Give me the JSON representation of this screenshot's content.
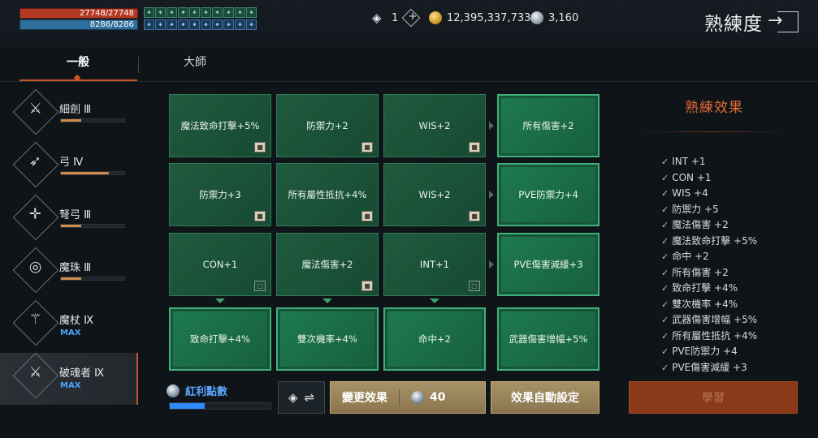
{
  "status": {
    "hp": "27748/27748",
    "mp": "8286/8286"
  },
  "buffs": [
    "✦",
    "✦",
    "✦",
    "✦",
    "✦",
    "✦",
    "✦",
    "✦",
    "✦",
    "✦",
    "✦",
    "✦",
    "✦",
    "✦",
    "✦",
    "✦",
    "✦",
    "✦",
    "✦",
    "✦"
  ],
  "currencies": {
    "diamond": "1",
    "gold": "12,395,337,733",
    "silver": "3,160"
  },
  "page_title": "熟練度",
  "tabs": [
    "一般",
    "大師"
  ],
  "weapons": [
    {
      "name": "細劍 Ⅲ",
      "progress": 0.32,
      "max": ""
    },
    {
      "name": "弓 Ⅳ",
      "progress": 0.75,
      "max": ""
    },
    {
      "name": "弩弓 Ⅲ",
      "progress": 0.32,
      "max": ""
    },
    {
      "name": "魔珠 Ⅲ",
      "progress": 0.32,
      "max": ""
    },
    {
      "name": "魔杖 Ⅸ",
      "progress": 1.0,
      "max": "MAX"
    },
    {
      "name": "破魂者 Ⅸ",
      "progress": 1.0,
      "max": "MAX"
    }
  ],
  "grid": [
    {
      "label": "魔法致命打擊+5%",
      "lock": "closed",
      "active": false
    },
    {
      "label": "防禦力+2",
      "lock": "closed",
      "active": false
    },
    {
      "label": "WIS+2",
      "lock": "closed",
      "active": false
    },
    {
      "label": "所有傷害+2",
      "lock": "",
      "active": true
    },
    {
      "label": "防禦力+3",
      "lock": "closed",
      "active": false
    },
    {
      "label": "所有屬性抵抗+4%",
      "lock": "closed",
      "active": false
    },
    {
      "label": "WIS+2",
      "lock": "closed",
      "active": false
    },
    {
      "label": "PVE防禦力+4",
      "lock": "",
      "active": true
    },
    {
      "label": "CON+1",
      "lock": "open",
      "active": false
    },
    {
      "label": "魔法傷害+2",
      "lock": "closed",
      "active": false
    },
    {
      "label": "INT+1",
      "lock": "open",
      "active": false
    },
    {
      "label": "PVE傷害減緩+3",
      "lock": "",
      "active": true
    },
    {
      "label": "致命打擊+4%",
      "lock": "",
      "active": true
    },
    {
      "label": "雙次機率+4%",
      "lock": "",
      "active": true
    },
    {
      "label": "命中+2",
      "lock": "",
      "active": true
    },
    {
      "label": "武器傷害增幅+5%",
      "lock": "",
      "active": true
    }
  ],
  "effects_title": "熟練效果",
  "effects": [
    "INT +1",
    "CON +1",
    "WIS +4",
    "防禦力 +5",
    "魔法傷害 +2",
    "魔法致命打擊 +5%",
    "命中 +2",
    "所有傷害 +2",
    "致命打擊 +4%",
    "雙次機率 +4%",
    "武器傷害增幅 +5%",
    "所有屬性抵抗 +4%",
    "PVE防禦力 +4",
    "PVE傷害減緩 +3"
  ],
  "bonus": {
    "label": "紅利點數",
    "progress": 0.35
  },
  "buttons": {
    "change": "變更效果",
    "change_cost": "40",
    "auto": "效果自動設定",
    "learn": "學習"
  }
}
